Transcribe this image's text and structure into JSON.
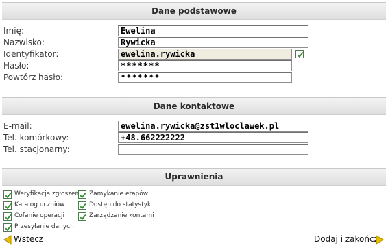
{
  "sections": {
    "basic": "Dane podstawowe",
    "contact": "Dane kontaktowe",
    "permissions": "Uprawnienia"
  },
  "basic_fields": {
    "first_name_label": "Imię:",
    "first_name_value": "Ewelina",
    "last_name_label": "Nazwisko:",
    "last_name_value": "Rywicka",
    "identifier_label": "Identyfikator:",
    "identifier_value": "ewelina.rywicka",
    "password_label": "Hasło:",
    "password_value": "*******",
    "password_repeat_label": "Powtórz hasło:",
    "password_repeat_value": "*******"
  },
  "contact_fields": {
    "email_label": "E-mail:",
    "email_value": "ewelina.rywicka@zst1wloclawek.pl",
    "mobile_label": "Tel. komórkowy:",
    "mobile_value": "+48.662222222",
    "landline_label": "Tel. stacjonarny:",
    "landline_value": ""
  },
  "permissions": {
    "items": [
      {
        "label": "Weryfikacja zgłoszeń",
        "checked": true
      },
      {
        "label": "Katalog uczniów",
        "checked": true
      },
      {
        "label": "Cofanie operacji",
        "checked": true
      },
      {
        "label": "Przesyłanie danych",
        "checked": true
      },
      {
        "label": "Zamykanie etapów",
        "checked": true
      },
      {
        "label": "Dostęp do statystyk",
        "checked": true
      },
      {
        "label": "Zarządzanie kontami",
        "checked": true
      }
    ]
  },
  "navigation": {
    "back_label": "Wstecz",
    "submit_label": "Dodaj i zakończ"
  },
  "colors": {
    "check": "#2e8b2e",
    "arrow": "#e8c000",
    "arrow_outline": "#b08a00"
  },
  "icons": {
    "identifier_check": "checkbox-checked-icon",
    "back": "arrow-left-icon",
    "forward": "arrow-right-icon"
  }
}
